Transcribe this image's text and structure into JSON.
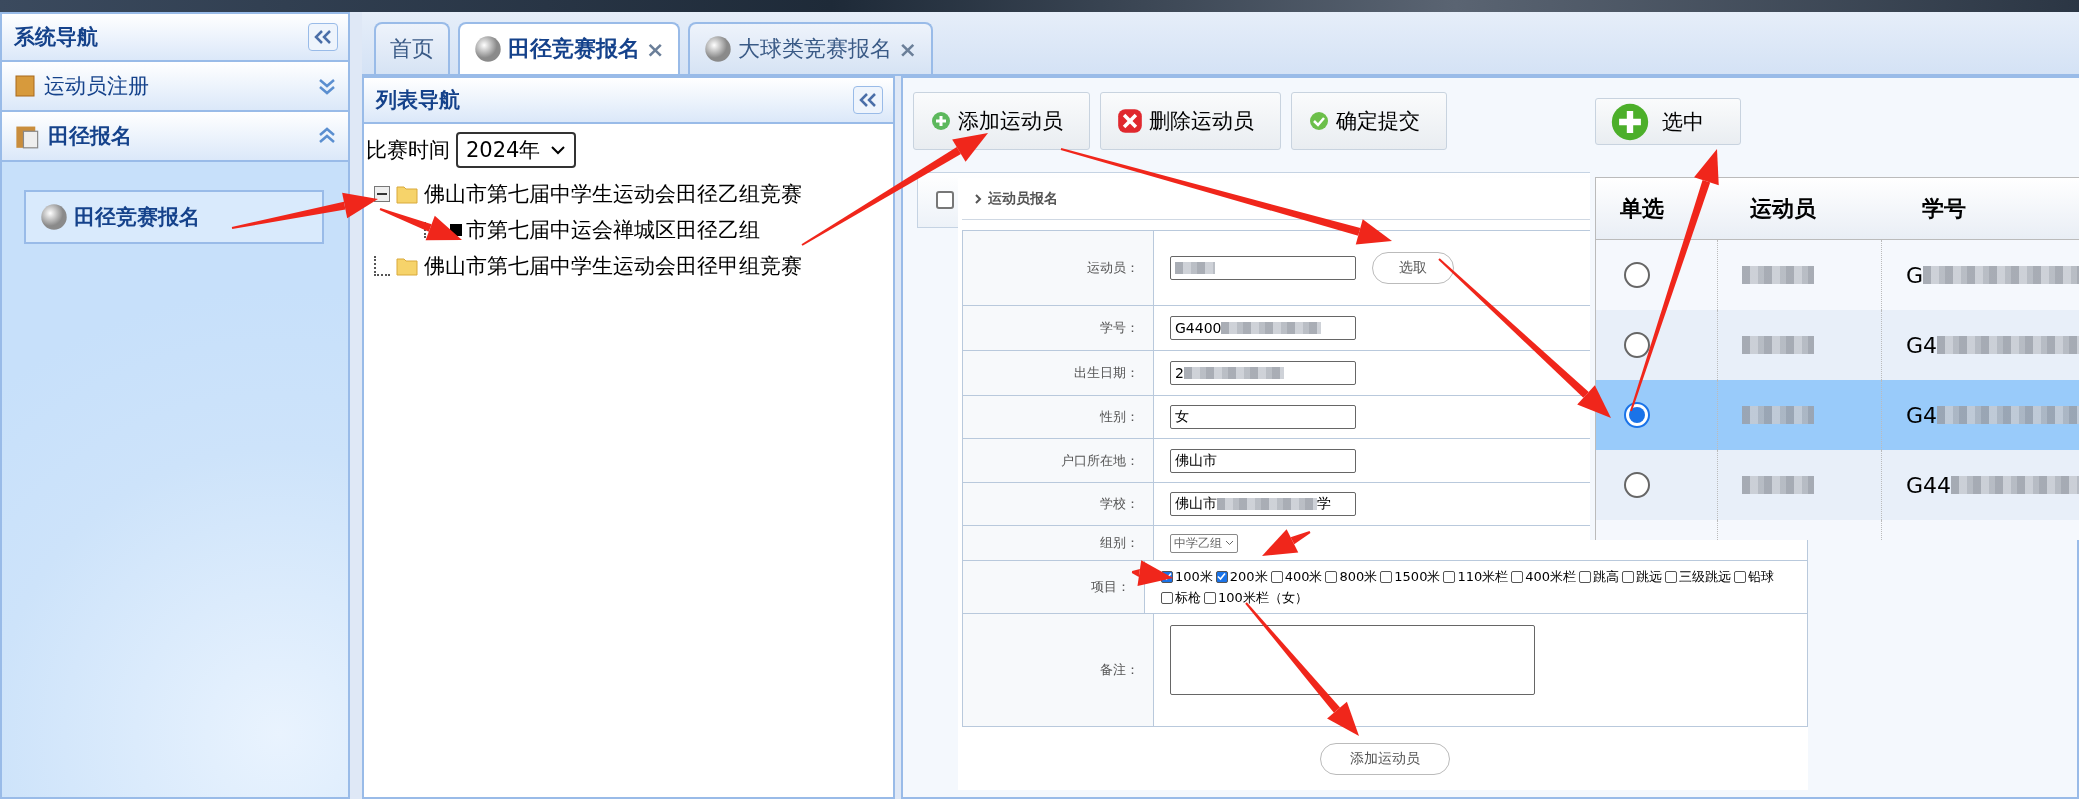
{
  "sidebar": {
    "title": "系统导航",
    "sections": [
      {
        "label": "运动员注册",
        "expanded": false
      },
      {
        "label": "田径报名",
        "expanded": true,
        "items": [
          {
            "label": "田径竞赛报名"
          }
        ]
      }
    ]
  },
  "tabs": [
    {
      "label": "首页",
      "selected": false
    },
    {
      "label": "田径竞赛报名",
      "selected": true,
      "close": "×"
    },
    {
      "label": "大球类竞赛报名",
      "selected": false,
      "close": "×"
    }
  ],
  "list_nav": {
    "title": "列表导航",
    "filter_label": "比赛时间",
    "filter_value": "2024年",
    "tree": [
      {
        "label": "佛山市第七届中学生运动会田径乙组竞赛",
        "expanded": true,
        "children": [
          {
            "label": "市第七届中运会禅城区田径乙组"
          }
        ]
      },
      {
        "label": "佛山市第七届中学生运动会田径甲组竞赛",
        "expanded": false
      }
    ]
  },
  "toolbar": [
    {
      "label": "添加运动员",
      "kind": "add"
    },
    {
      "label": "删除运动员",
      "kind": "delete"
    },
    {
      "label": "确定提交",
      "kind": "confirm"
    }
  ],
  "list_header": {
    "checked": false
  },
  "form": {
    "breadcrumb": "运动员报名",
    "fields": [
      {
        "label": "运动员：",
        "kind": "text",
        "blurred": true,
        "button": "选取"
      },
      {
        "label": "学号：",
        "kind": "text",
        "value": "G4400",
        "blurred": true
      },
      {
        "label": "出生日期：",
        "kind": "text",
        "value": "2",
        "blurred": true
      },
      {
        "label": "性别：",
        "kind": "text",
        "value": "女"
      },
      {
        "label": "户口所在地：",
        "kind": "text",
        "value": "佛山市"
      },
      {
        "label": "学校：",
        "kind": "text",
        "value": "佛山市",
        "blurred": true,
        "tail": "学"
      },
      {
        "label": "组别：",
        "kind": "select",
        "value": "中学乙组"
      },
      {
        "label": "项目：",
        "kind": "checks",
        "options": [
          {
            "label": "100米",
            "checked": true
          },
          {
            "label": "200米",
            "checked": true
          },
          {
            "label": "400米",
            "checked": false
          },
          {
            "label": "800米",
            "checked": false
          },
          {
            "label": "1500米",
            "checked": false
          },
          {
            "label": "110米栏",
            "checked": false
          },
          {
            "label": "400米栏",
            "checked": false
          },
          {
            "label": "跳高",
            "checked": false
          },
          {
            "label": "跳远",
            "checked": false
          },
          {
            "label": "三级跳远",
            "checked": false
          },
          {
            "label": "铅球",
            "checked": false
          },
          {
            "label": "标枪",
            "checked": false
          },
          {
            "label": "100米栏（女）",
            "checked": false
          }
        ]
      },
      {
        "label": "备注：",
        "kind": "textarea"
      }
    ],
    "submit": "添加运动员"
  },
  "picker": {
    "button": "选中",
    "columns": [
      "单选",
      "运动员",
      "学号"
    ],
    "rows": [
      {
        "selected": false,
        "id": "G"
      },
      {
        "selected": false,
        "id": "G4"
      },
      {
        "selected": true,
        "id": "G4"
      },
      {
        "selected": false,
        "id": "G44"
      }
    ]
  }
}
